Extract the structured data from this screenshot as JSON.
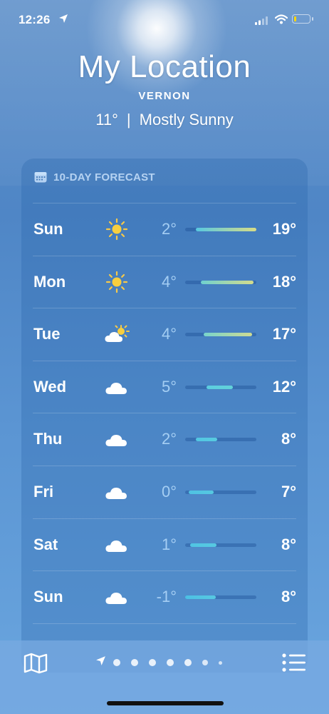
{
  "status_bar": {
    "time": "12:26",
    "icons": [
      "location-arrow-icon",
      "signal-icon",
      "wifi-icon",
      "battery-icon"
    ],
    "battery_color": "#ffd60a"
  },
  "header": {
    "title": "My Location",
    "subtitle": "VERNON",
    "temperature": "11°",
    "separator": "|",
    "condition": "Mostly Sunny"
  },
  "forecast": {
    "label": "10-DAY FORECAST",
    "icon": "calendar-icon",
    "rows": [
      {
        "day": "Sun",
        "icon": "sun-icon",
        "low": "2°",
        "high": "19°",
        "bar_start": 0.15,
        "bar_end": 1.0,
        "bar_colors": [
          "#57c8e1",
          "#d8dc86"
        ]
      },
      {
        "day": "Mon",
        "icon": "sun-icon",
        "low": "4°",
        "high": "18°",
        "bar_start": 0.22,
        "bar_end": 0.96,
        "bar_colors": [
          "#6fd0cf",
          "#d4dc8c"
        ]
      },
      {
        "day": "Tue",
        "icon": "sun-behind-cloud-icon",
        "low": "4°",
        "high": "17°",
        "bar_start": 0.26,
        "bar_end": 0.94,
        "bar_colors": [
          "#78d4cc",
          "#cfdb92"
        ]
      },
      {
        "day": "Wed",
        "icon": "cloud-icon",
        "low": "5°",
        "high": "12°",
        "bar_start": 0.3,
        "bar_end": 0.67,
        "bar_colors": [
          "#5ccde0",
          "#62d2d9"
        ]
      },
      {
        "day": "Thu",
        "icon": "cloud-icon",
        "low": "2°",
        "high": "8°",
        "bar_start": 0.15,
        "bar_end": 0.45,
        "bar_colors": [
          "#52c6e2",
          "#58cbe0"
        ]
      },
      {
        "day": "Fri",
        "icon": "cloud-icon",
        "low": "0°",
        "high": "7°",
        "bar_start": 0.05,
        "bar_end": 0.4,
        "bar_colors": [
          "#4fc2e3",
          "#56c8e1"
        ]
      },
      {
        "day": "Sat",
        "icon": "cloud-icon",
        "low": "1°",
        "high": "8°",
        "bar_start": 0.07,
        "bar_end": 0.44,
        "bar_colors": [
          "#50c4e3",
          "#57c9e1"
        ]
      },
      {
        "day": "Sun",
        "icon": "cloud-icon",
        "low": "-1°",
        "high": "8°",
        "bar_start": 0.0,
        "bar_end": 0.43,
        "bar_colors": [
          "#4cc0e4",
          "#57c9e1"
        ]
      }
    ]
  },
  "bottom_bar": {
    "left_icon": "map-icon",
    "right_icon": "list-icon",
    "pager": {
      "current_icon": "location-arrow-icon",
      "dots": 7
    }
  }
}
